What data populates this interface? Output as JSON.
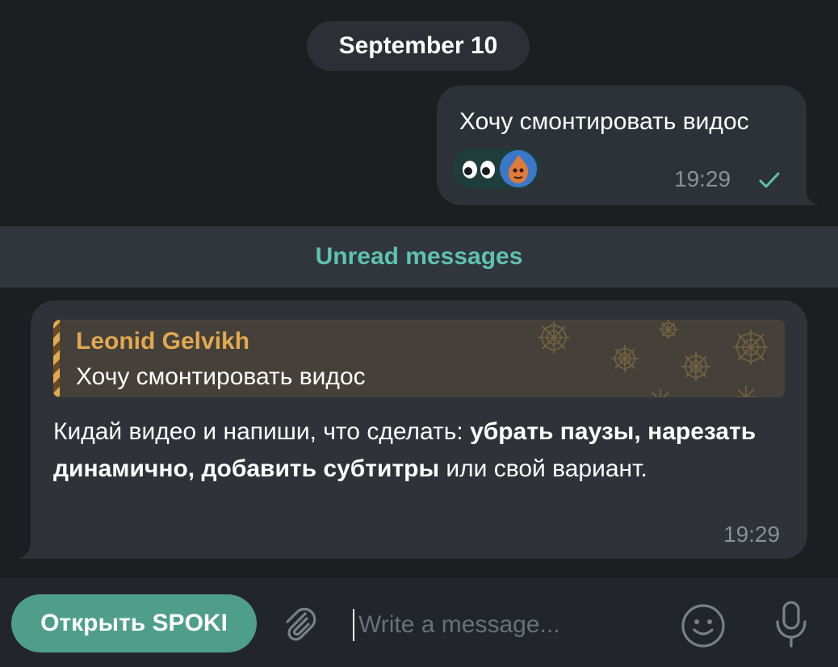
{
  "date_separator": "September 10",
  "outgoing_message": {
    "text": "Хочу смонтировать видос",
    "time": "19:29",
    "reactions": [
      "eyes-emoji",
      "avatar"
    ],
    "status": "sent-check"
  },
  "unread_divider": "Unread messages",
  "incoming_message": {
    "reply_to": {
      "author": "Leonid Gelvikh",
      "text": "Хочу смонтировать видос"
    },
    "text_part1": "Кидай видео и напиши, что сделать: ",
    "bold1": "убрать паузы",
    "sep1": ", ",
    "bold2": "нарезать динамично",
    "sep2": ", ",
    "bold3": "добавить субтитры",
    "text_part2": " или свой вариант.",
    "time": "19:29"
  },
  "composer": {
    "bot_button_label": "Открыть SPOKI",
    "placeholder": "Write a message..."
  },
  "colors": {
    "background": "#1c1e22",
    "accent": "#5ec2ae",
    "bot_button": "#4f9e8a",
    "quote_author": "#e2a850",
    "check": "#5ec2ae"
  },
  "icons": [
    "paperclip-icon",
    "emoji-icon",
    "microphone-icon",
    "checkmark-icon",
    "cobweb-icon"
  ]
}
